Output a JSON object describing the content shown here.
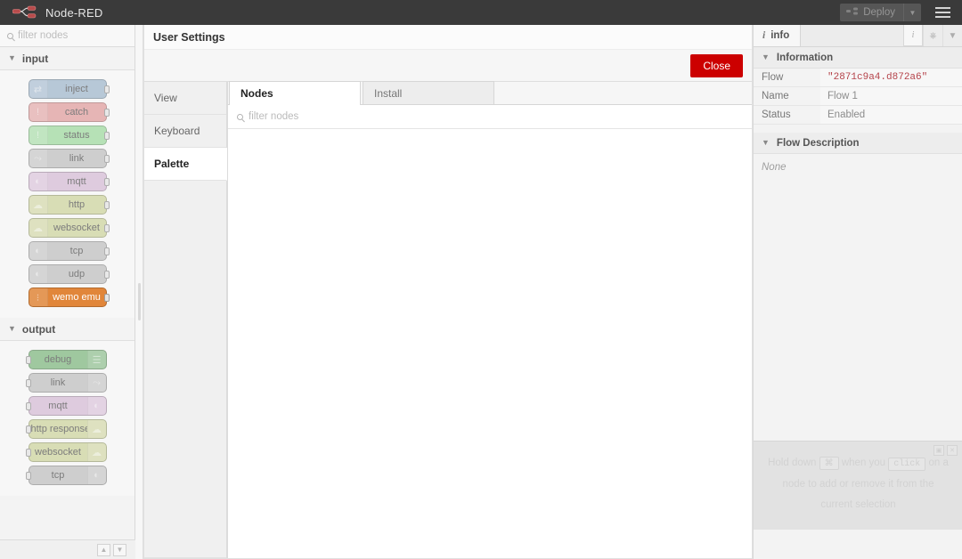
{
  "header": {
    "app_title": "Node-RED",
    "logo_icon": "node-red-logo-icon",
    "deploy_label": "Deploy",
    "deploy_icon": "deploy-icon",
    "deploy_caret_icon": "chevron-down-icon",
    "menu_icon": "hamburger-menu-icon",
    "deploy_disabled": true,
    "bar_color": "#3a3a3a"
  },
  "palette": {
    "search_placeholder": "filter nodes",
    "search_icon": "search-icon",
    "collapse_all_icon": "chevron-up-icon",
    "expand_all_icon": "chevron-down-icon",
    "categories": [
      {
        "name": "input",
        "expanded": true,
        "nodes": [
          {
            "label": "inject",
            "color": "#a6bbcf",
            "icon": "⇄",
            "side": "in"
          },
          {
            "label": "catch",
            "color": "#e2a3a3",
            "icon": "!",
            "side": "in"
          },
          {
            "label": "status",
            "color": "#a5dba5",
            "icon": "!",
            "side": "in"
          },
          {
            "label": "link",
            "color": "#c3c3c3",
            "icon": "⤳",
            "side": "in"
          },
          {
            "label": "mqtt",
            "color": "#d8bfd8",
            "icon": "ᴶ",
            "side": "in"
          },
          {
            "label": "http",
            "color": "#d0d6a3",
            "icon": "☁",
            "side": "in"
          },
          {
            "label": "websocket",
            "color": "#d0d6a3",
            "icon": "☁",
            "side": "in"
          },
          {
            "label": "tcp",
            "color": "#c3c3c3",
            "icon": "ᴶ",
            "side": "in"
          },
          {
            "label": "udp",
            "color": "#c3c3c3",
            "icon": "ᴶ",
            "side": "in"
          },
          {
            "label": "wemo emu",
            "color": "#e08030",
            "icon": "⁙",
            "side": "in"
          }
        ]
      },
      {
        "name": "output",
        "expanded": true,
        "nodes": [
          {
            "label": "debug",
            "color": "#87bb87",
            "icon": "☰",
            "side": "out"
          },
          {
            "label": "link",
            "color": "#c3c3c3",
            "icon": "⤳",
            "side": "out"
          },
          {
            "label": "mqtt",
            "color": "#d8bfd8",
            "icon": "ᴶ",
            "side": "out"
          },
          {
            "label": "http response",
            "color": "#d0d6a3",
            "icon": "☁",
            "side": "out"
          },
          {
            "label": "websocket",
            "color": "#d0d6a3",
            "icon": "☁",
            "side": "out"
          },
          {
            "label": "tcp",
            "color": "#c3c3c3",
            "icon": "ᴶ",
            "side": "out"
          }
        ]
      }
    ]
  },
  "settings_dialog": {
    "title": "User Settings",
    "close_label": "Close",
    "close_color": "#cc0000",
    "nav_items": [
      {
        "label": "View",
        "active": false
      },
      {
        "label": "Keyboard",
        "active": false
      },
      {
        "label": "Palette",
        "active": true
      }
    ],
    "palette_tabs": [
      {
        "label": "Nodes",
        "active": true
      },
      {
        "label": "Install",
        "active": false
      }
    ],
    "filter_placeholder": "filter nodes",
    "filter_icon": "search-icon"
  },
  "sidebar": {
    "tab_label": "info",
    "tab_icon": "info-icon",
    "buttons": [
      {
        "icon": "info-icon",
        "name": "sidebar-button-info",
        "glyph": "i",
        "active": true
      },
      {
        "icon": "outline-icon",
        "name": "sidebar-button-outline",
        "glyph": "⚘",
        "active": false
      },
      {
        "icon": "chevron-down-icon",
        "name": "sidebar-button-menu",
        "glyph": "▾",
        "active": false
      }
    ],
    "information": {
      "header": "Information",
      "rows": [
        {
          "key": "Flow",
          "value": "\"2871c9a4.d872a6\"",
          "code": true
        },
        {
          "key": "Name",
          "value": "Flow 1",
          "code": false
        },
        {
          "key": "Status",
          "value": "Enabled",
          "code": false
        }
      ]
    },
    "flow_description": {
      "header": "Flow Description",
      "body": "None"
    },
    "tip": {
      "part1": "Hold down",
      "key1": "⌘",
      "part2": "when you",
      "key2": "click",
      "part3": "on",
      "line2": "a node to add or remove it from the",
      "line3": "current selection",
      "refresh_icon": "refresh-icon",
      "close_icon": "close-icon"
    }
  }
}
